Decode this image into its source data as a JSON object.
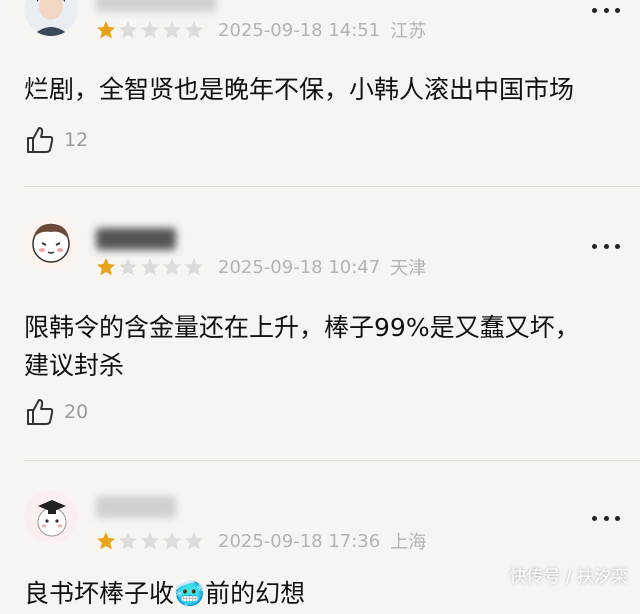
{
  "comments": [
    {
      "date": "2025-09-18 14:51",
      "location": "江苏",
      "rating": 1,
      "text": "烂剧，全智贤也是晚年不保，小韩人滚出中国市场",
      "likes": "12"
    },
    {
      "date": "2025-09-18 10:47",
      "location": "天津",
      "rating": 1,
      "text_line1": "限韩令的含金量还在上升，棒子99%是又蠢又坏，",
      "text_line2": "建议封杀",
      "likes": "20"
    },
    {
      "date": "2025-09-18 17:36",
      "location": "上海",
      "rating": 1,
      "text": "良书坏棒子收🥶前的幻想"
    }
  ],
  "watermark": "快传号 / 扶汐栾",
  "colors": {
    "background": "#f6f5f1",
    "star_filled": "#e8a317",
    "star_empty": "#dcdcdc",
    "meta_text": "#b3b3b3"
  },
  "icons": [
    "thumbs-up-icon",
    "star-icon",
    "more-dots-icon"
  ]
}
